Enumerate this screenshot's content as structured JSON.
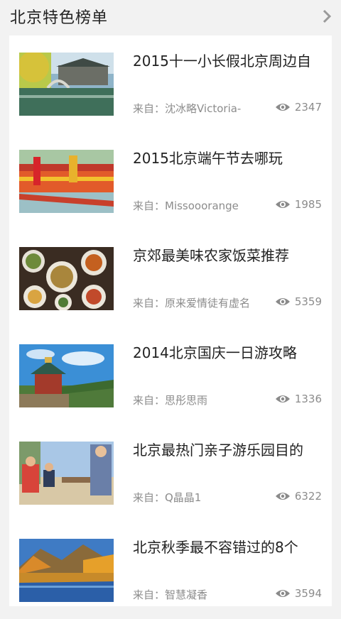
{
  "header": {
    "title": "北京特色榜单",
    "arrow_icon": "chevron-right-icon"
  },
  "items": [
    {
      "title": "2015十一小长假北京周边自",
      "source": "来自：沈冰略Victoria-",
      "views": "2347"
    },
    {
      "title": "2015北京端午节去哪玩",
      "source": "来自：Missooorange",
      "views": "1985"
    },
    {
      "title": "京郊最美味农家饭菜推荐",
      "source": "来自：原来爱情徒有虚名",
      "views": "5359"
    },
    {
      "title": "2014北京国庆一日游攻略",
      "source": "来自：思彤思雨",
      "views": "1336"
    },
    {
      "title": "北京最热门亲子游乐园目的",
      "source": "来自：Q晶晶1",
      "views": "6322"
    },
    {
      "title": "北京秋季最不容错过的8个",
      "source": "来自：智慧凝香",
      "views": "3594"
    }
  ],
  "colors": {
    "background": "#f2f2f2",
    "card": "#ffffff",
    "meta_text": "#8c8c8c",
    "eye_icon": "#8a8a8a"
  }
}
